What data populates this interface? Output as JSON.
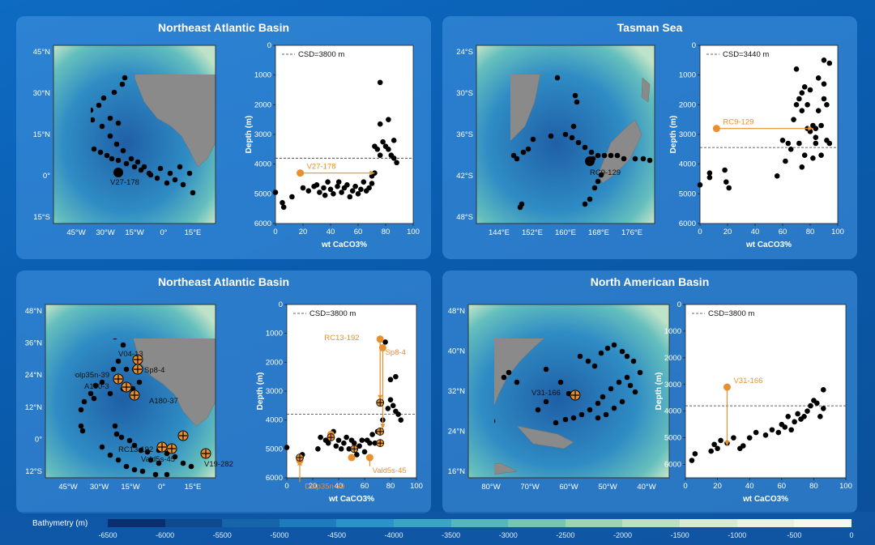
{
  "panels": [
    {
      "title": "Northeast Atlantic Basin",
      "map": {
        "lat_labels": [
          "45°N",
          "30°N",
          "15°N",
          "0°",
          "15°S"
        ],
        "lon_labels": [
          "45°W",
          "30°W",
          "15°W",
          "0°",
          "15°E"
        ],
        "core_labels": [
          "V27-178"
        ]
      },
      "chart_data": {
        "type": "scatter",
        "xlabel": "wt CaCO3%",
        "ylabel": "Depth (m)",
        "xlim": [
          0,
          100
        ],
        "ylim": [
          6000,
          0
        ],
        "xticks": [
          "0",
          "20",
          "40",
          "60",
          "80",
          "100"
        ],
        "yticks": [
          "0",
          "1000",
          "2000",
          "3000",
          "4000",
          "5000",
          "6000"
        ],
        "csd_label": "CSD=3800 m",
        "csd": 3800,
        "points": [
          [
            0,
            4950
          ],
          [
            5,
            5300
          ],
          [
            6,
            5450
          ],
          [
            12,
            5100
          ],
          [
            20,
            4800
          ],
          [
            24,
            4900
          ],
          [
            28,
            4750
          ],
          [
            30,
            4700
          ],
          [
            32,
            4950
          ],
          [
            35,
            4800
          ],
          [
            36,
            5050
          ],
          [
            38,
            4600
          ],
          [
            40,
            4850
          ],
          [
            42,
            5000
          ],
          [
            45,
            4750
          ],
          [
            46,
            4600
          ],
          [
            48,
            4950
          ],
          [
            50,
            4800
          ],
          [
            52,
            4700
          ],
          [
            54,
            5100
          ],
          [
            56,
            4900
          ],
          [
            58,
            4750
          ],
          [
            60,
            5000
          ],
          [
            62,
            4850
          ],
          [
            64,
            4600
          ],
          [
            66,
            4900
          ],
          [
            68,
            4800
          ],
          [
            70,
            4650
          ],
          [
            70,
            4400
          ],
          [
            72,
            4300
          ],
          [
            72,
            3400
          ],
          [
            74,
            3500
          ],
          [
            76,
            3700
          ],
          [
            78,
            3250
          ],
          [
            80,
            3400
          ],
          [
            82,
            3500
          ],
          [
            84,
            3700
          ],
          [
            86,
            3800
          ],
          [
            88,
            3950
          ],
          [
            76,
            2650
          ],
          [
            82,
            2500
          ],
          [
            86,
            3200
          ],
          [
            76,
            1250
          ]
        ],
        "orange": {
          "value": [
            18,
            4300
          ],
          "label": "V27-178",
          "target": [
            72,
            4300
          ],
          "dir": "h"
        }
      }
    },
    {
      "title": "Tasman Sea",
      "map": {
        "lat_labels": [
          "24°S",
          "30°S",
          "36°S",
          "42°S",
          "48°S"
        ],
        "lon_labels": [
          "144°E",
          "152°E",
          "160°E",
          "168°E",
          "176°E"
        ],
        "core_labels": [
          "RC9-129"
        ]
      },
      "chart_data": {
        "type": "scatter",
        "xlabel": "wt CaCO3%",
        "ylabel": "Depth (m)",
        "xlim": [
          0,
          100
        ],
        "ylim": [
          6000,
          0
        ],
        "xticks": [
          "0",
          "20",
          "40",
          "60",
          "80",
          "100"
        ],
        "yticks": [
          "0",
          "1000",
          "2000",
          "3000",
          "4000",
          "5000",
          "6000"
        ],
        "csd_label": "CSD=3440 m",
        "csd": 3440,
        "points": [
          [
            0,
            4700
          ],
          [
            7,
            4300
          ],
          [
            7,
            4450
          ],
          [
            18,
            4200
          ],
          [
            19,
            4600
          ],
          [
            21,
            4800
          ],
          [
            56,
            4400
          ],
          [
            60,
            3200
          ],
          [
            62,
            3900
          ],
          [
            64,
            3300
          ],
          [
            66,
            3500
          ],
          [
            68,
            2500
          ],
          [
            70,
            2000
          ],
          [
            70,
            800
          ],
          [
            72,
            1800
          ],
          [
            74,
            1600
          ],
          [
            74,
            2200
          ],
          [
            76,
            1400
          ],
          [
            76,
            3700
          ],
          [
            78,
            2000
          ],
          [
            78,
            2800
          ],
          [
            80,
            2900
          ],
          [
            80,
            1500
          ],
          [
            82,
            2700
          ],
          [
            84,
            3100
          ],
          [
            84,
            3300
          ],
          [
            86,
            2200
          ],
          [
            86,
            1100
          ],
          [
            88,
            2700
          ],
          [
            88,
            3700
          ],
          [
            90,
            1300
          ],
          [
            90,
            1800
          ],
          [
            90,
            500
          ],
          [
            92,
            2000
          ],
          [
            92,
            3200
          ],
          [
            94,
            3300
          ],
          [
            94,
            600
          ],
          [
            72,
            3300
          ],
          [
            74,
            4100
          ],
          [
            84,
            2800
          ],
          [
            82,
            3800
          ]
        ],
        "orange": {
          "value": [
            12,
            2800
          ],
          "label": "RC9-129",
          "target": [
            82,
            2800
          ],
          "dir": "h"
        }
      }
    },
    {
      "title": "Northeast Atlantic Basin",
      "map": {
        "lat_labels": [
          "48°N",
          "36°N",
          "24°N",
          "12°N",
          "0°",
          "12°S"
        ],
        "lon_labels": [
          "45°W",
          "30°W",
          "15°W",
          "0°",
          "15°E"
        ],
        "core_labels": [
          "V04-13",
          "Sp8-4",
          "Dolp35n-39",
          "A180-3",
          "A180-37",
          "RC13-192",
          "Vald5s-45",
          "V19-282"
        ]
      },
      "chart_data": {
        "type": "scatter",
        "xlabel": "wt CaCO3%",
        "ylabel": "Depth (m)",
        "xlim": [
          0,
          100
        ],
        "ylim": [
          6000,
          0
        ],
        "xticks": [
          "0",
          "20",
          "40",
          "60",
          "80",
          "100"
        ],
        "yticks": [
          "0",
          "1000",
          "2000",
          "3000",
          "4000",
          "5000",
          "6000"
        ],
        "csd_label": "CSD=3800 m",
        "csd": 3800,
        "points": [
          [
            0,
            4950
          ],
          [
            10,
            5300
          ],
          [
            12,
            5200
          ],
          [
            24,
            5000
          ],
          [
            26,
            4600
          ],
          [
            30,
            4700
          ],
          [
            32,
            4800
          ],
          [
            34,
            4500
          ],
          [
            36,
            4400
          ],
          [
            38,
            4900
          ],
          [
            40,
            4700
          ],
          [
            42,
            5000
          ],
          [
            44,
            4800
          ],
          [
            46,
            4600
          ],
          [
            48,
            5000
          ],
          [
            50,
            4700
          ],
          [
            52,
            4800
          ],
          [
            54,
            5200
          ],
          [
            56,
            4900
          ],
          [
            58,
            4700
          ],
          [
            60,
            5100
          ],
          [
            62,
            4700
          ],
          [
            64,
            4800
          ],
          [
            66,
            4500
          ],
          [
            68,
            4800
          ],
          [
            70,
            4400
          ],
          [
            72,
            4800
          ],
          [
            72,
            3400
          ],
          [
            74,
            4000
          ],
          [
            78,
            3600
          ],
          [
            80,
            3300
          ],
          [
            82,
            3500
          ],
          [
            84,
            3700
          ],
          [
            86,
            3800
          ],
          [
            88,
            4000
          ],
          [
            80,
            2600
          ],
          [
            84,
            2500
          ],
          [
            76,
            1300
          ]
        ],
        "orange_points": [
          [
            10,
            5400
          ],
          [
            34,
            4500
          ],
          [
            50,
            5300
          ],
          [
            64,
            5300
          ],
          [
            72,
            1200
          ],
          [
            74,
            1500
          ]
        ],
        "orange_labels": [
          {
            "t": "RC13-192",
            "v": [
              56,
              1150
            ],
            "a": "end"
          },
          {
            "t": "Sp8-4",
            "v": [
              76,
              1650
            ],
            "a": "start"
          },
          {
            "t": "Dolp35n-39",
            "v": [
              14,
              6300
            ],
            "a": "start"
          },
          {
            "t": "Vald5s-45",
            "v": [
              66,
              5750
            ],
            "a": "start"
          }
        ],
        "arrows": [
          [
            72,
            1250,
            72,
            3300
          ],
          [
            74,
            1550,
            74,
            4300
          ],
          [
            10,
            6150,
            10,
            5400
          ],
          [
            64,
            5600,
            64,
            5200
          ]
        ]
      }
    },
    {
      "title": "North American Basin",
      "map": {
        "lat_labels": [
          "48°N",
          "40°N",
          "32°N",
          "24°N",
          "16°N"
        ],
        "lon_labels": [
          "80°W",
          "70°W",
          "60°W",
          "50°W",
          "40°W"
        ],
        "core_labels": [
          "V31-166"
        ]
      },
      "chart_data": {
        "type": "scatter",
        "xlabel": "wt CaCO3%",
        "ylabel": "Depth (m)",
        "xlim": [
          0,
          100
        ],
        "ylim": [
          6500,
          0
        ],
        "xticks": [
          "0",
          "20",
          "40",
          "60",
          "80",
          "100"
        ],
        "yticks": [
          "0",
          "1000",
          "2000",
          "3000",
          "4000",
          "5000",
          "6000"
        ],
        "csd_label": "CSD=3800 m",
        "csd": 3800,
        "points": [
          [
            4,
            5850
          ],
          [
            6,
            5600
          ],
          [
            16,
            5500
          ],
          [
            18,
            5250
          ],
          [
            20,
            5400
          ],
          [
            22,
            5100
          ],
          [
            26,
            5200
          ],
          [
            30,
            5000
          ],
          [
            34,
            5400
          ],
          [
            36,
            5300
          ],
          [
            40,
            5000
          ],
          [
            44,
            4800
          ],
          [
            50,
            4900
          ],
          [
            54,
            4700
          ],
          [
            58,
            4800
          ],
          [
            60,
            4500
          ],
          [
            62,
            4600
          ],
          [
            64,
            4200
          ],
          [
            66,
            4700
          ],
          [
            68,
            4400
          ],
          [
            70,
            4100
          ],
          [
            72,
            4300
          ],
          [
            74,
            4200
          ],
          [
            76,
            4000
          ],
          [
            78,
            3800
          ],
          [
            80,
            3600
          ],
          [
            82,
            3700
          ],
          [
            84,
            4200
          ],
          [
            86,
            3200
          ],
          [
            86,
            3900
          ]
        ],
        "orange": {
          "value": [
            26,
            3100
          ],
          "label": "V31-166",
          "target": [
            26,
            5300
          ],
          "dir": "v"
        }
      }
    }
  ],
  "colorbar": {
    "title": "Bathymetry (m)",
    "ticks": [
      "-6500",
      "-6000",
      "-5500",
      "-5000",
      "-4500",
      "-4000",
      "-3500",
      "-3000",
      "-2500",
      "-2000",
      "-1500",
      "-1000",
      "-500",
      "0"
    ],
    "colors": [
      "#0a2e6e",
      "#0f4a8c",
      "#1565a8",
      "#1c7cbe",
      "#2a93c8",
      "#3aa5c4",
      "#55b6bd",
      "#76c4b6",
      "#9cd2b6",
      "#bde0c4",
      "#d6ead6",
      "#e7f1e6",
      "#f3f8f3"
    ]
  },
  "style": {
    "accent": "#e8902e",
    "point": "#000000",
    "land": "#8a8a8a"
  }
}
